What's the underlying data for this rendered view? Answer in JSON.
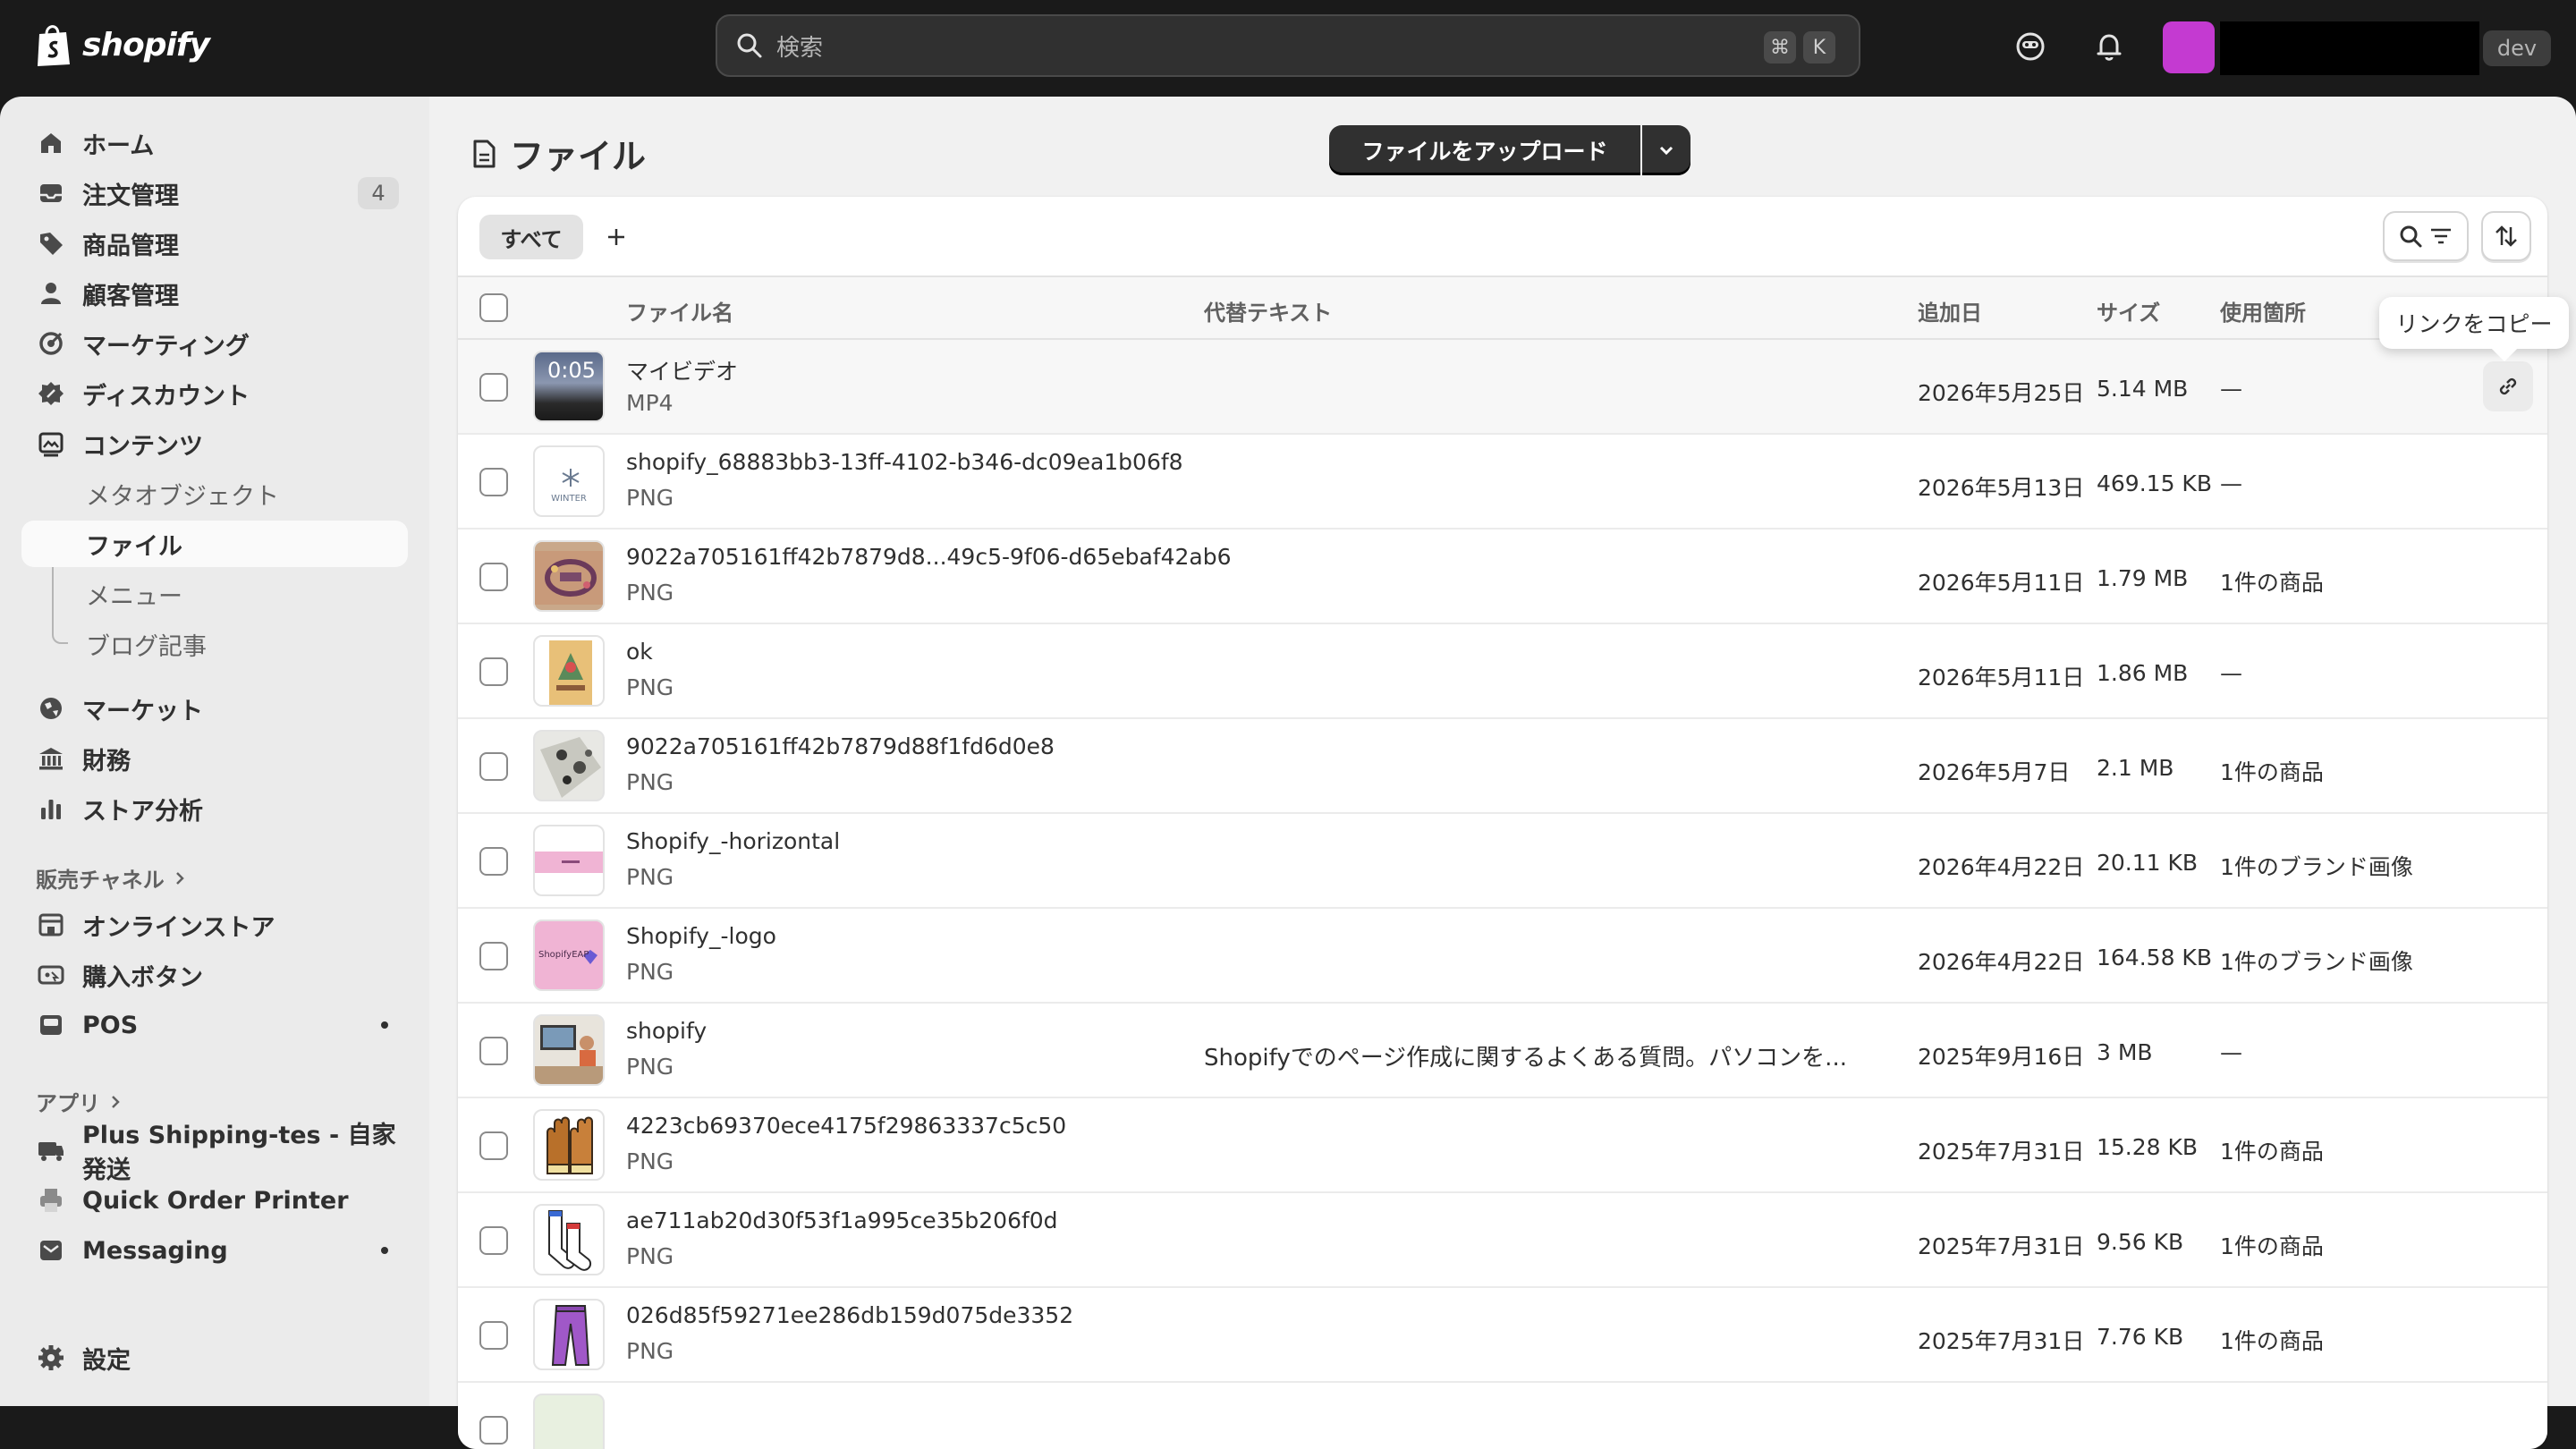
{
  "brand": {
    "name": "shopify"
  },
  "topbar": {
    "search_placeholder": "検索",
    "shortcut_cmd": "⌘",
    "shortcut_key": "K",
    "dev_badge": "dev"
  },
  "sidebar": {
    "items": [
      {
        "label": "ホーム",
        "icon": "home-icon"
      },
      {
        "label": "注文管理",
        "icon": "inbox-icon",
        "badge": "4"
      },
      {
        "label": "商品管理",
        "icon": "tag-icon"
      },
      {
        "label": "顧客管理",
        "icon": "person-icon"
      },
      {
        "label": "マーケティング",
        "icon": "target-icon"
      },
      {
        "label": "ディスカウント",
        "icon": "discount-icon"
      },
      {
        "label": "コンテンツ",
        "icon": "content-icon"
      }
    ],
    "content_sub": [
      {
        "label": "メタオブジェクト"
      },
      {
        "label": "ファイル"
      },
      {
        "label": "メニュー"
      },
      {
        "label": "ブログ記事"
      }
    ],
    "items2": [
      {
        "label": "マーケット",
        "icon": "globe-icon"
      },
      {
        "label": "財務",
        "icon": "bank-icon"
      },
      {
        "label": "ストア分析",
        "icon": "chart-icon"
      }
    ],
    "sales_channels_heading": "販売チャネル",
    "channels": [
      {
        "label": "オンラインストア",
        "icon": "store-icon"
      },
      {
        "label": "購入ボタン",
        "icon": "buy-button-icon"
      },
      {
        "label": "POS",
        "icon": "pos-icon"
      }
    ],
    "apps_heading": "アプリ",
    "apps": [
      {
        "label": "Plus Shipping-tes - 自家発送",
        "icon": "shipping-app-icon"
      },
      {
        "label": "Quick Order Printer",
        "icon": "printer-app-icon"
      },
      {
        "label": "Messaging",
        "icon": "messaging-app-icon"
      }
    ],
    "settings_label": "設定"
  },
  "main": {
    "title": "ファイル",
    "upload_label": "ファイルをアップロード",
    "tab_all": "すべて",
    "tooltip": "リンクをコピー",
    "columns": {
      "filename": "ファイル名",
      "alt": "代替テキスト",
      "date": "追加日",
      "size": "サイズ",
      "usage": "使用箇所"
    },
    "rows": [
      {
        "name": "マイビデオ",
        "type": "MP4",
        "alt": "",
        "date": "2026年5月25日",
        "size": "5.14 MB",
        "usage": "—",
        "thumb": "video",
        "duration": "0:05"
      },
      {
        "name": "shopify_68883bb3-13ff-4102-b346-dc09ea1b06f8",
        "type": "PNG",
        "alt": "",
        "date": "2026年5月13日",
        "size": "469.15 KB",
        "usage": "—",
        "thumb": "winter",
        "thumb_text": "WINTER"
      },
      {
        "name": "9022a705161ff42b7879d8...49c5-9f06-d65ebaf42ab6",
        "type": "PNG",
        "alt": "",
        "date": "2026年5月11日",
        "size": "1.79 MB",
        "usage": "1件の商品",
        "thumb": "wreath"
      },
      {
        "name": "ok",
        "type": "PNG",
        "alt": "",
        "date": "2026年5月11日",
        "size": "1.86 MB",
        "usage": "—",
        "thumb": "poster"
      },
      {
        "name": "9022a705161ff42b7879d88f1fd6d0e8",
        "type": "PNG",
        "alt": "",
        "date": "2026年5月7日",
        "size": "2.1 MB",
        "usage": "1件の商品",
        "thumb": "scarf"
      },
      {
        "name": "Shopify_-horizontal",
        "type": "PNG",
        "alt": "",
        "date": "2026年4月22日",
        "size": "20.11 KB",
        "usage": "1件のブランド画像",
        "thumb": "pinkband"
      },
      {
        "name": "Shopify_-logo",
        "type": "PNG",
        "alt": "",
        "date": "2026年4月22日",
        "size": "164.58 KB",
        "usage": "1件のブランド画像",
        "thumb": "pinklogo",
        "thumb_text": "ShopifyEAP"
      },
      {
        "name": "shopify",
        "type": "PNG",
        "alt": "Shopifyでのページ作成に関するよくある質問。パソコンを...",
        "date": "2025年9月16日",
        "size": "3 MB",
        "usage": "—",
        "thumb": "desk"
      },
      {
        "name": "4223cb69370ece4175f29863337c5c50",
        "type": "PNG",
        "alt": "",
        "date": "2025年7月31日",
        "size": "15.28 KB",
        "usage": "1件の商品",
        "thumb": "gloves"
      },
      {
        "name": "ae711ab20d30f53f1a995ce35b206f0d",
        "type": "PNG",
        "alt": "",
        "date": "2025年7月31日",
        "size": "9.56 KB",
        "usage": "1件の商品",
        "thumb": "socks"
      },
      {
        "name": "026d85f59271ee286db159d075de3352",
        "type": "PNG",
        "alt": "",
        "date": "2025年7月31日",
        "size": "7.76 KB",
        "usage": "1件の商品",
        "thumb": "pants"
      }
    ]
  },
  "colors": {
    "topbar_bg": "#1a1a1a",
    "avatar": "#c43ad1",
    "primary_button": "#303030",
    "page_bg": "#f1f1f1",
    "sidebar_bg": "#ebebeb"
  }
}
